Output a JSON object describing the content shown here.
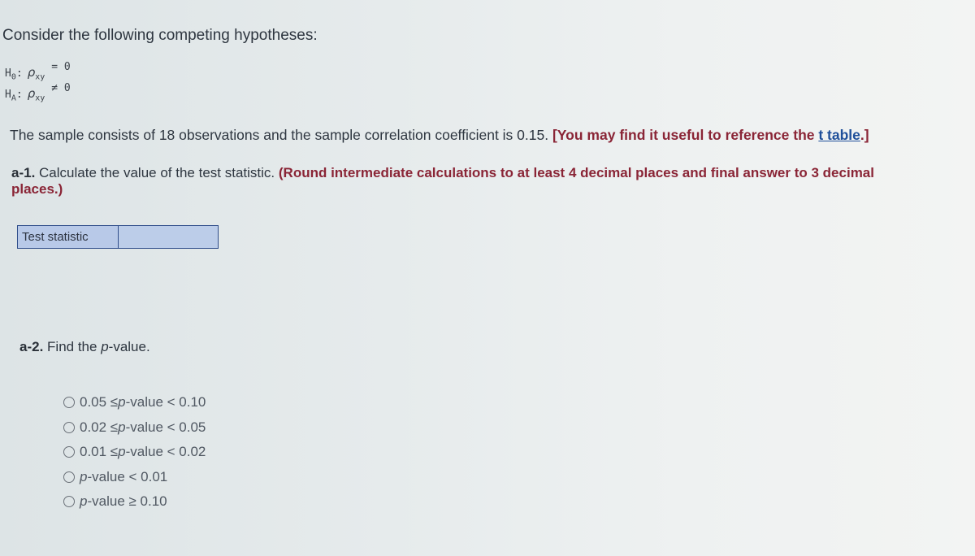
{
  "intro": "Consider the following competing hypotheses:",
  "hypotheses": {
    "h0": {
      "label": "H",
      "sub": "0",
      "param": "ρ",
      "param_sub": "xy",
      "relation": "= 0"
    },
    "ha": {
      "label": "H",
      "sub": "A",
      "param": "ρ",
      "param_sub": "xy",
      "relation": "≠ 0"
    }
  },
  "sample_text": "The sample consists of 18 observations and the sample correlation coefficient is 0.15.",
  "reference_note": {
    "prefix": "[You may find it useful to reference the ",
    "link": "t table",
    "suffix": ".]"
  },
  "question_a1": {
    "number": "a-1.",
    "text": "Calculate the value of the test statistic.",
    "instruction": "(Round intermediate calculations to at least 4 decimal places and final answer to 3 decimal places.)",
    "field_label": "Test statistic",
    "field_value": ""
  },
  "question_a2": {
    "number": "a-2.",
    "text_prefix": "Find the ",
    "text_italic": "p",
    "text_suffix": "-value.",
    "options": [
      {
        "pre": "0.05 ≤ ",
        "p": "p",
        "post": "-value < 0.10"
      },
      {
        "pre": "0.02 ≤ ",
        "p": "p",
        "post": "-value < 0.05"
      },
      {
        "pre": "0.01 ≤ ",
        "p": "p",
        "post": "-value < 0.02"
      },
      {
        "pre": "",
        "p": "p",
        "post": "-value < 0.01"
      },
      {
        "pre": "",
        "p": "p",
        "post": "-value ≥ 0.10"
      }
    ]
  }
}
